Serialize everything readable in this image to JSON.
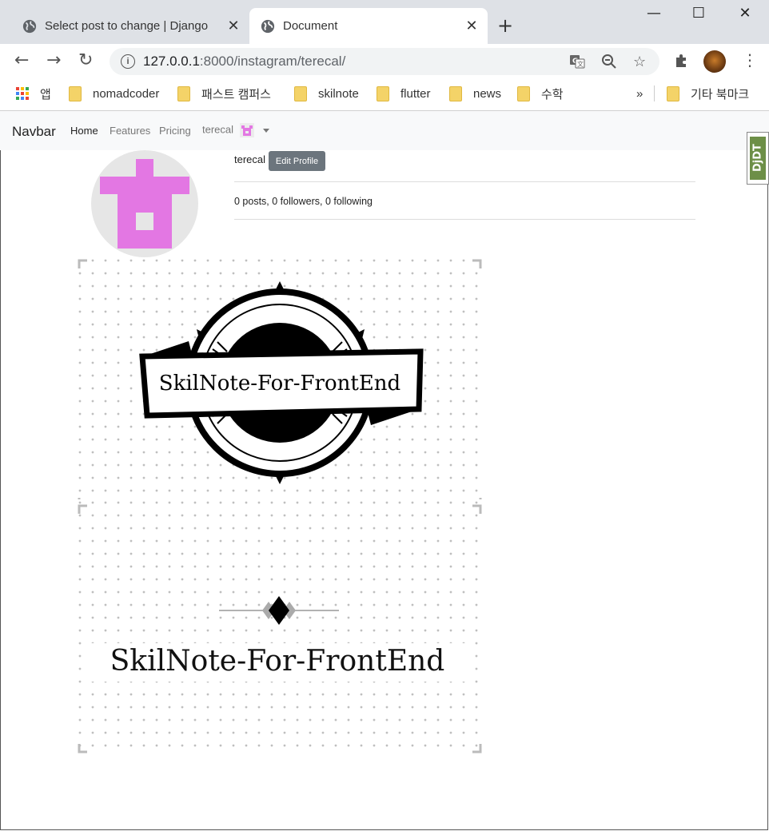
{
  "browser": {
    "tabs": [
      {
        "title": "Select post to change | Django",
        "close": "✕"
      },
      {
        "title": "Document",
        "close": "✕"
      }
    ],
    "new_tab": "+",
    "window_controls": {
      "minimize": "—",
      "maximize": "☐",
      "close": "✕"
    },
    "address": {
      "host": "127.0.0.1",
      "port": ":8000",
      "path": "/instagram/terecal/"
    },
    "bookmarks": [
      "앱",
      "nomadcoder",
      "패스트 캠퍼스",
      "skilnote",
      "flutter",
      "news",
      "수학"
    ],
    "bookmarks_overflow": "»",
    "other_bookmarks": "기타 북마크"
  },
  "navbar": {
    "brand": "Navbar",
    "links": [
      "Home",
      "Features",
      "Pricing"
    ],
    "user": "terecal"
  },
  "debug_toolbar": "DjDT",
  "profile": {
    "username": "terecal",
    "edit_button": "Edit Profile",
    "stats": "0 posts, 0 followers, 0 following",
    "avatar_color": "#e377e3"
  },
  "posts": [
    {
      "logo_text": "SkilNote-For-FrontEnd"
    },
    {
      "logo_text": "SkilNote-For-FrontEnd"
    }
  ]
}
